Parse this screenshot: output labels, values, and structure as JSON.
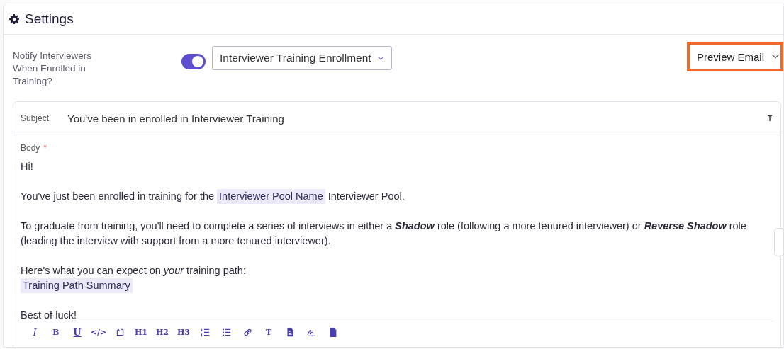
{
  "header": {
    "title": "Settings"
  },
  "notify": {
    "label": "Notify Interviewers When Enrolled in Training?",
    "on": true,
    "template": "Interviewer Training Enrollment"
  },
  "preview": {
    "label": "Preview Email",
    "highlighted": true
  },
  "subject": {
    "label": "Subject",
    "value": "You've been in enrolled in Interviewer Training",
    "format_button": "T"
  },
  "body": {
    "label": "Body",
    "required_mark": "*",
    "paragraphs": [
      [
        [
          {
            "kind": "text",
            "text": "Hi!"
          }
        ]
      ],
      [
        [
          {
            "kind": "text",
            "text": "You've just been enrolled in training for the"
          },
          {
            "kind": "token",
            "text": "Interviewer Pool Name"
          },
          {
            "kind": "text",
            "text": "Interviewer Pool."
          }
        ]
      ],
      [
        [
          {
            "kind": "text",
            "text": "To graduate from training, you'll need to complete a series of interviews in either a **Shadow** role (following a more tenured interviewer) or **Reverse Shadow** role (leading the interview with support from a more tenured interviewer)."
          }
        ]
      ],
      [
        [
          {
            "kind": "text",
            "text": "Here's what you can expect on *your* training path:"
          }
        ],
        [
          {
            "kind": "token",
            "text": "Training Path Summary"
          }
        ]
      ],
      [
        [
          {
            "kind": "text",
            "text": "Best of luck!"
          }
        ]
      ]
    ]
  },
  "toolbar": [
    {
      "kind": "italic",
      "label": "I"
    },
    {
      "kind": "bold",
      "label": "B"
    },
    {
      "kind": "underline",
      "label": "U"
    },
    {
      "kind": "code",
      "label": "</>"
    },
    {
      "kind": "embed"
    },
    {
      "kind": "heading",
      "label": "H1"
    },
    {
      "kind": "heading",
      "label": "H2"
    },
    {
      "kind": "heading",
      "label": "H3"
    },
    {
      "kind": "numbered-list"
    },
    {
      "kind": "bullet-list"
    },
    {
      "kind": "link"
    },
    {
      "kind": "format",
      "label": "T"
    },
    {
      "kind": "image"
    },
    {
      "kind": "signature"
    },
    {
      "kind": "document"
    }
  ]
}
